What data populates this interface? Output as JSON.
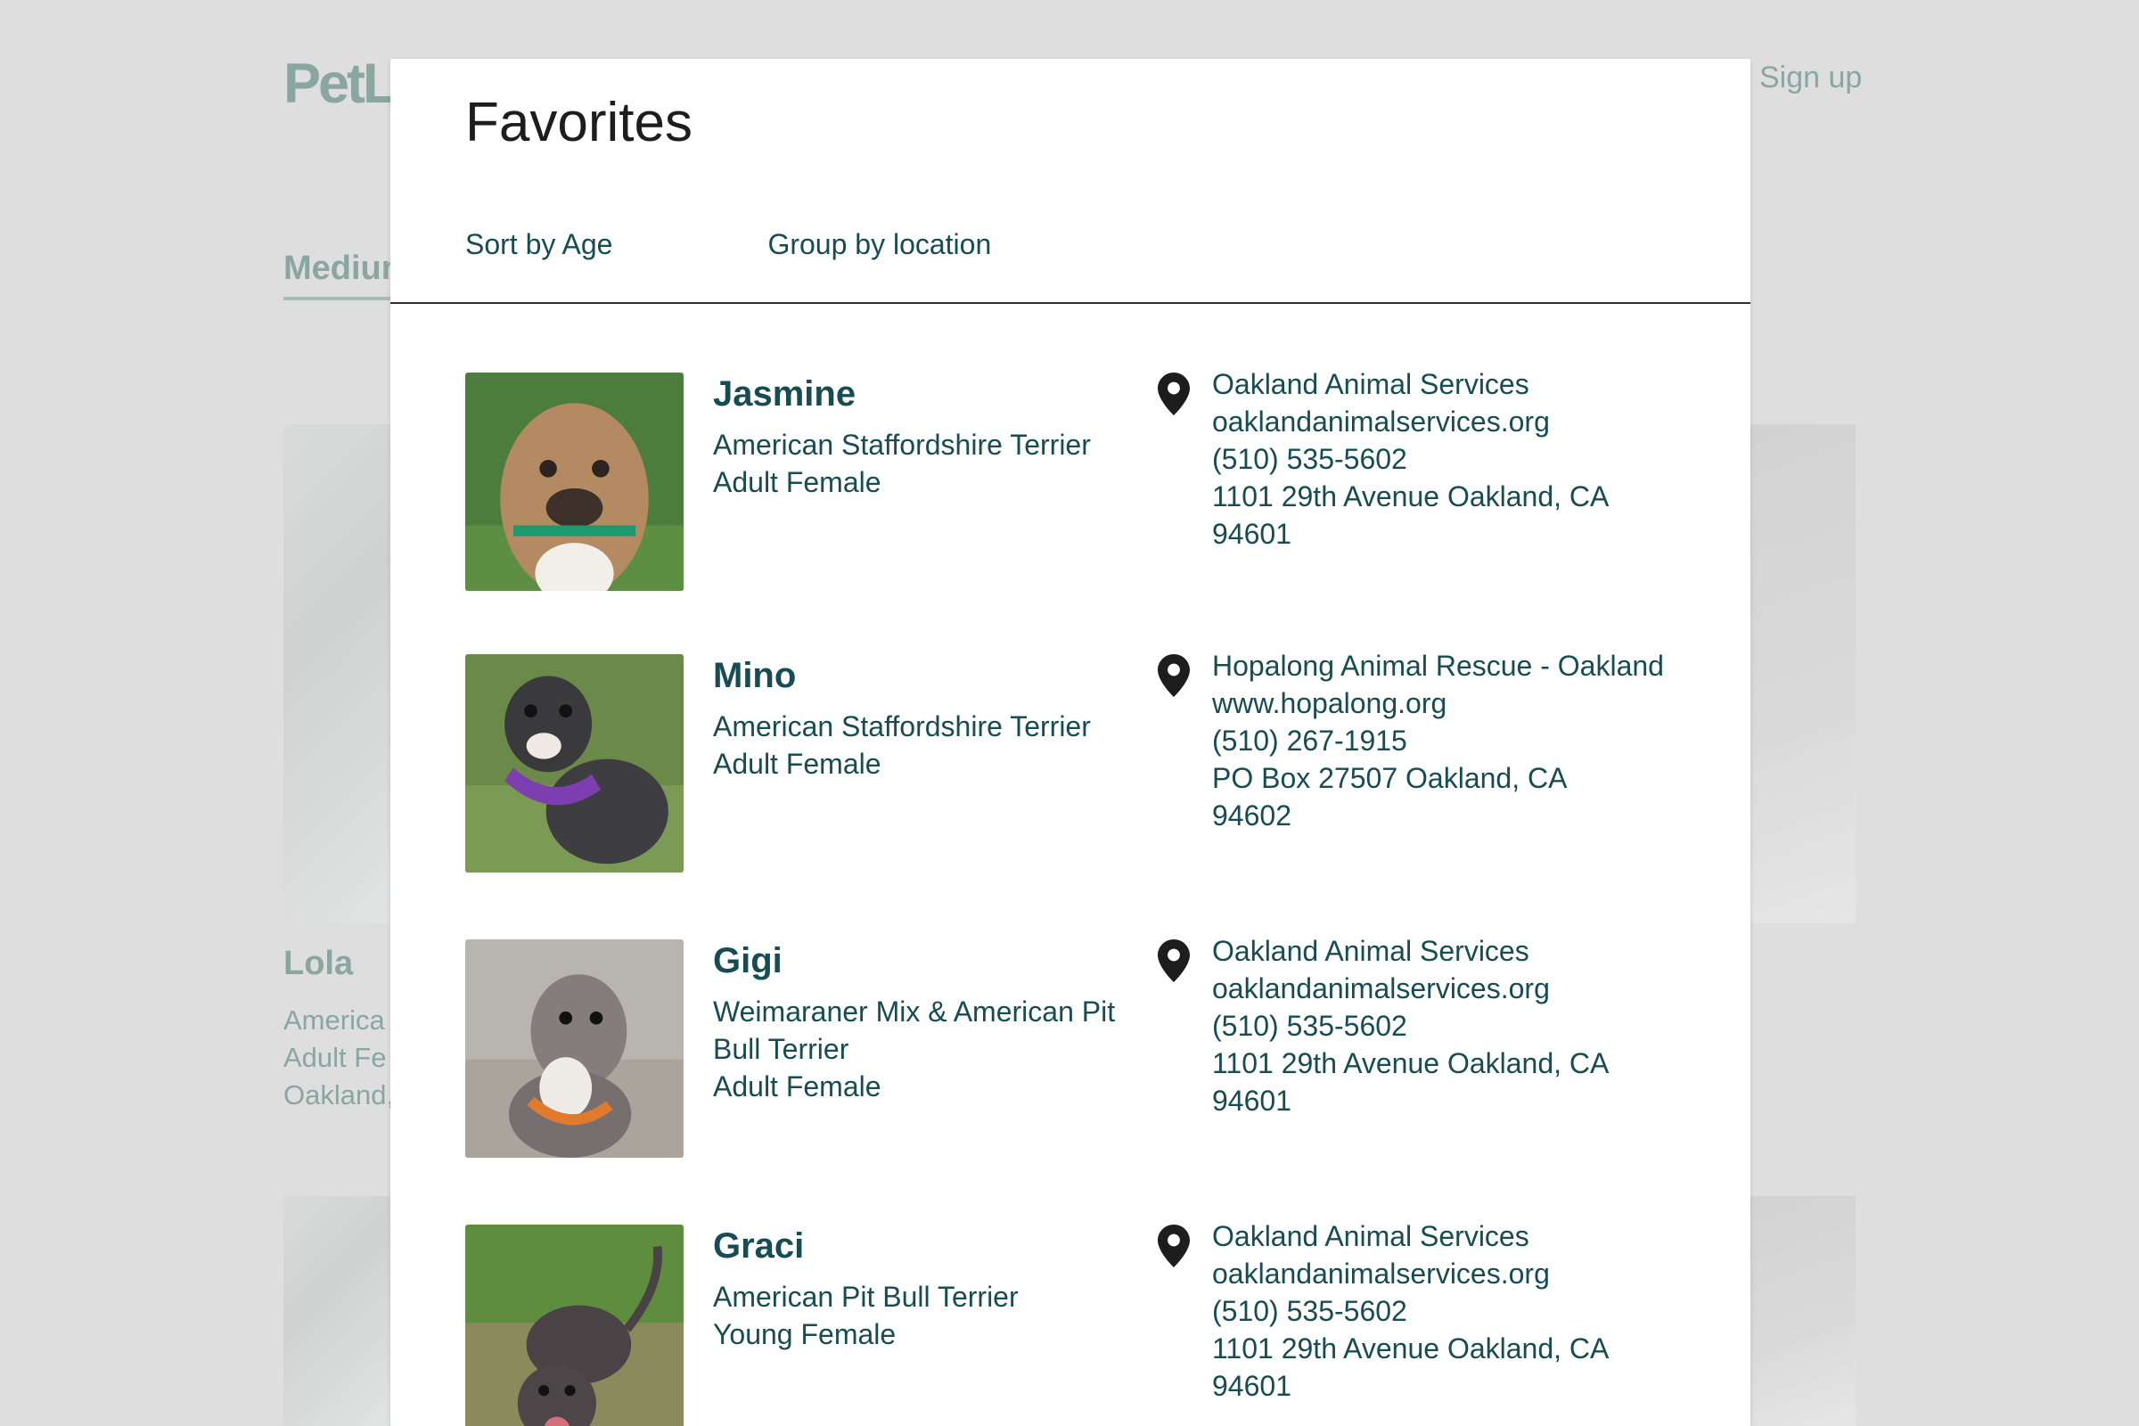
{
  "background": {
    "logo": "PetL",
    "signup_label": "Sign up",
    "filter_tab": "Medium",
    "pet_name": "Lola",
    "pet_breed": "America",
    "pet_age": "Adult Fe",
    "pet_location": "Oakland,"
  },
  "modal": {
    "title": "Favorites",
    "tabs": [
      {
        "label": "Sort by Age"
      },
      {
        "label": "Group by location"
      }
    ],
    "favorites": [
      {
        "name": "Jasmine",
        "breed": "American Staffordshire Terrier",
        "age_sex": "Adult Female",
        "photo": "dog-photo-jasmine",
        "org_name": "Oakland Animal Services",
        "website": "oaklandanimalservices.org",
        "phone": "(510) 535-5602",
        "address": "1101 29th Avenue Oakland, CA",
        "zip": "94601"
      },
      {
        "name": "Mino",
        "breed": "American Staffordshire Terrier",
        "age_sex": "Adult Female",
        "photo": "dog-photo-mino",
        "org_name": "Hopalong Animal Rescue - Oakland",
        "website": "www.hopalong.org",
        "phone": "(510) 267-1915",
        "address": "PO Box 27507 Oakland, CA",
        "zip": "94602"
      },
      {
        "name": "Gigi",
        "breed": "Weimaraner Mix & American Pit Bull Terrier",
        "age_sex": "Adult Female",
        "photo": "dog-photo-gigi",
        "org_name": "Oakland Animal Services",
        "website": "oaklandanimalservices.org",
        "phone": "(510) 535-5602",
        "address": "1101 29th Avenue Oakland, CA",
        "zip": "94601"
      },
      {
        "name": "Graci",
        "breed": "American Pit Bull Terrier",
        "age_sex": "Young Female",
        "photo": "dog-photo-graci",
        "org_name": "Oakland Animal Services",
        "website": "oaklandanimalservices.org",
        "phone": "(510) 535-5602",
        "address": "1101 29th Avenue Oakland, CA",
        "zip": "94601"
      }
    ]
  },
  "icons": {
    "location": "map-pin-icon"
  },
  "colors": {
    "text_primary": "#174c52",
    "background_overlay": "#dedede",
    "faded_text": "#8aa6a1"
  }
}
